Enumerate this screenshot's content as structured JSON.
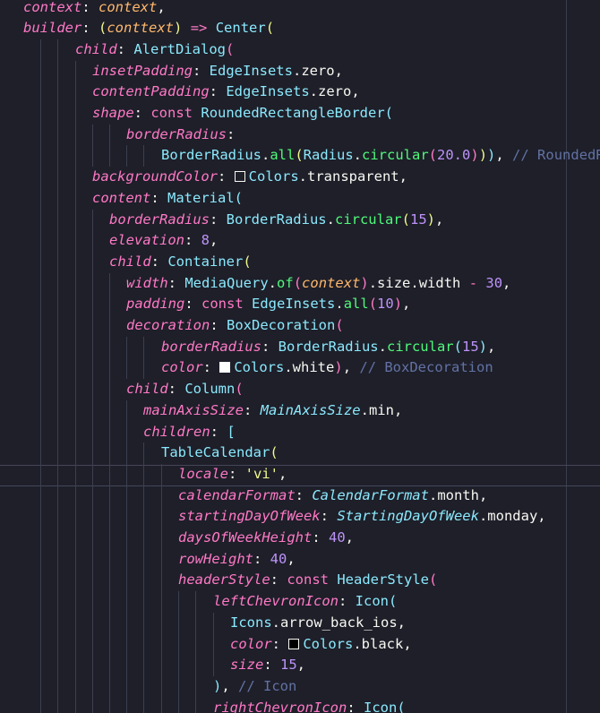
{
  "editor": {
    "language": "dart",
    "theme_colors": {
      "background": "#1e1f29",
      "param": "#ff79c6",
      "class": "#8be9fd",
      "function": "#50fa7b",
      "number": "#bd93f9",
      "string": "#f1fa8c",
      "comment": "#6272a4"
    },
    "lines": [
      {
        "tokens": [
          [
            "pn",
            "context"
          ],
          [
            "pu",
            ": "
          ],
          [
            "vi",
            "context"
          ],
          [
            "pu",
            ","
          ]
        ]
      },
      {
        "tokens": [
          [
            "pn",
            "builder"
          ],
          [
            "pu",
            ": "
          ],
          [
            "p1",
            "("
          ],
          [
            "vi",
            "conttext"
          ],
          [
            "p1",
            ")"
          ],
          [
            "pu",
            " "
          ],
          [
            "kw",
            "=>"
          ],
          [
            "pu",
            " "
          ],
          [
            "cl",
            "Center"
          ],
          [
            "p1",
            "("
          ]
        ]
      },
      {
        "tokens": [
          [
            "pn",
            "child"
          ],
          [
            "pu",
            ": "
          ],
          [
            "cl",
            "AlertDialog"
          ],
          [
            "p2",
            "("
          ]
        ]
      },
      {
        "tokens": [
          [
            "pn",
            "insetPadding"
          ],
          [
            "pu",
            ": "
          ],
          [
            "cl",
            "EdgeInsets"
          ],
          [
            "pu",
            ".zero,"
          ]
        ]
      },
      {
        "tokens": [
          [
            "pn",
            "contentPadding"
          ],
          [
            "pu",
            ": "
          ],
          [
            "cl",
            "EdgeInsets"
          ],
          [
            "pu",
            ".zero,"
          ]
        ]
      },
      {
        "tokens": [
          [
            "pn",
            "shape"
          ],
          [
            "pu",
            ": "
          ],
          [
            "kw",
            "const"
          ],
          [
            "pu",
            " "
          ],
          [
            "cl",
            "RoundedRectangleBorder"
          ],
          [
            "p3",
            "("
          ]
        ]
      },
      {
        "tokens": [
          [
            "pn",
            "borderRadius"
          ],
          [
            "pu",
            ":"
          ]
        ]
      },
      {
        "tokens": [
          [
            "cl",
            "BorderRadius"
          ],
          [
            "pu",
            "."
          ],
          [
            "fn",
            "all"
          ],
          [
            "p1",
            "("
          ],
          [
            "cl",
            "Radius"
          ],
          [
            "pu",
            "."
          ],
          [
            "fn",
            "circular"
          ],
          [
            "p2",
            "("
          ],
          [
            "nm",
            "20.0"
          ],
          [
            "p2",
            ")"
          ],
          [
            "p1",
            ")"
          ],
          [
            "p3",
            ")"
          ],
          [
            "pu",
            ", "
          ],
          [
            "cm",
            "// RoundedRectangleBorder"
          ]
        ]
      },
      {
        "tokens": [
          [
            "pn",
            "backgroundColor"
          ],
          [
            "pu",
            ": "
          ],
          [
            "sw",
            "#1e1f29"
          ],
          [
            "cl",
            "Colors"
          ],
          [
            "pu",
            ".transparent,"
          ]
        ]
      },
      {
        "tokens": [
          [
            "pn",
            "content"
          ],
          [
            "pu",
            ": "
          ],
          [
            "cl",
            "Material"
          ],
          [
            "p3",
            "("
          ]
        ]
      },
      {
        "tokens": [
          [
            "pn",
            "borderRadius"
          ],
          [
            "pu",
            ": "
          ],
          [
            "cl",
            "BorderRadius"
          ],
          [
            "pu",
            "."
          ],
          [
            "fn",
            "circular"
          ],
          [
            "p1",
            "("
          ],
          [
            "nm",
            "15"
          ],
          [
            "p1",
            ")"
          ],
          [
            "pu",
            ","
          ]
        ]
      },
      {
        "tokens": [
          [
            "pn",
            "elevation"
          ],
          [
            "pu",
            ": "
          ],
          [
            "nm",
            "8"
          ],
          [
            "pu",
            ","
          ]
        ]
      },
      {
        "tokens": [
          [
            "pn",
            "child"
          ],
          [
            "pu",
            ": "
          ],
          [
            "cl",
            "Container"
          ],
          [
            "p1",
            "("
          ]
        ]
      },
      {
        "tokens": [
          [
            "pn",
            "width"
          ],
          [
            "pu",
            ": "
          ],
          [
            "cl",
            "MediaQuery"
          ],
          [
            "pu",
            "."
          ],
          [
            "fn",
            "of"
          ],
          [
            "p2",
            "("
          ],
          [
            "vi",
            "context"
          ],
          [
            "p2",
            ")"
          ],
          [
            "pu",
            ".size.width "
          ],
          [
            "kw",
            "-"
          ],
          [
            "pu",
            " "
          ],
          [
            "nm",
            "30"
          ],
          [
            "pu",
            ","
          ]
        ]
      },
      {
        "tokens": [
          [
            "pn",
            "padding"
          ],
          [
            "pu",
            ": "
          ],
          [
            "kw",
            "const"
          ],
          [
            "pu",
            " "
          ],
          [
            "cl",
            "EdgeInsets"
          ],
          [
            "pu",
            "."
          ],
          [
            "fn",
            "all"
          ],
          [
            "p2",
            "("
          ],
          [
            "nm",
            "10"
          ],
          [
            "p2",
            ")"
          ],
          [
            "pu",
            ","
          ]
        ]
      },
      {
        "tokens": [
          [
            "pn",
            "decoration"
          ],
          [
            "pu",
            ": "
          ],
          [
            "cl",
            "BoxDecoration"
          ],
          [
            "p2",
            "("
          ]
        ]
      },
      {
        "tokens": [
          [
            "pn",
            "borderRadius"
          ],
          [
            "pu",
            ": "
          ],
          [
            "cl",
            "BorderRadius"
          ],
          [
            "pu",
            "."
          ],
          [
            "fn",
            "circular"
          ],
          [
            "p3",
            "("
          ],
          [
            "nm",
            "15"
          ],
          [
            "p3",
            ")"
          ],
          [
            "pu",
            ","
          ]
        ]
      },
      {
        "tokens": [
          [
            "pn",
            "color"
          ],
          [
            "pu",
            ": "
          ],
          [
            "sw",
            "#ffffff"
          ],
          [
            "cl",
            "Colors"
          ],
          [
            "pu",
            ".white"
          ],
          [
            "p2",
            ")"
          ],
          [
            "pu",
            ", "
          ],
          [
            "cm",
            "// BoxDecoration"
          ]
        ]
      },
      {
        "tokens": [
          [
            "pn",
            "child"
          ],
          [
            "pu",
            ": "
          ],
          [
            "cl",
            "Column"
          ],
          [
            "p2",
            "("
          ]
        ]
      },
      {
        "tokens": [
          [
            "pn",
            "mainAxisSize"
          ],
          [
            "pu",
            ": "
          ],
          [
            "cli",
            "MainAxisSize"
          ],
          [
            "pu",
            ".min,"
          ]
        ]
      },
      {
        "tokens": [
          [
            "pn",
            "children"
          ],
          [
            "pu",
            ": "
          ],
          [
            "p3",
            "["
          ]
        ]
      },
      {
        "tokens": [
          [
            "cl",
            "TableCalendar"
          ],
          [
            "p1",
            "("
          ]
        ]
      },
      {
        "tokens": [
          [
            "pn",
            "locale"
          ],
          [
            "pu",
            ": "
          ],
          [
            "st",
            "'vi'"
          ],
          [
            "pu",
            ","
          ]
        ]
      },
      {
        "tokens": [
          [
            "pn",
            "calendarFormat"
          ],
          [
            "pu",
            ": "
          ],
          [
            "cli",
            "CalendarFormat"
          ],
          [
            "pu",
            ".month,"
          ]
        ]
      },
      {
        "tokens": [
          [
            "pn",
            "startingDayOfWeek"
          ],
          [
            "pu",
            ": "
          ],
          [
            "cli",
            "StartingDayOfWeek"
          ],
          [
            "pu",
            ".monday,"
          ]
        ]
      },
      {
        "tokens": [
          [
            "pn",
            "daysOfWeekHeight"
          ],
          [
            "pu",
            ": "
          ],
          [
            "nm",
            "40"
          ],
          [
            "pu",
            ","
          ]
        ]
      },
      {
        "tokens": [
          [
            "pn",
            "rowHeight"
          ],
          [
            "pu",
            ": "
          ],
          [
            "nm",
            "40"
          ],
          [
            "pu",
            ","
          ]
        ]
      },
      {
        "tokens": [
          [
            "pn",
            "headerStyle"
          ],
          [
            "pu",
            ": "
          ],
          [
            "kw",
            "const"
          ],
          [
            "pu",
            " "
          ],
          [
            "cl",
            "HeaderStyle"
          ],
          [
            "p2",
            "("
          ]
        ]
      },
      {
        "tokens": [
          [
            "pn",
            "leftChevronIcon"
          ],
          [
            "pu",
            ": "
          ],
          [
            "cl",
            "Icon"
          ],
          [
            "p3",
            "("
          ]
        ]
      },
      {
        "tokens": [
          [
            "cl",
            "Icons"
          ],
          [
            "pu",
            ".arrow_back_ios,"
          ]
        ]
      },
      {
        "tokens": [
          [
            "pn",
            "color"
          ],
          [
            "pu",
            ": "
          ],
          [
            "sw",
            "#000000"
          ],
          [
            "cl",
            "Colors"
          ],
          [
            "pu",
            ".black,"
          ]
        ]
      },
      {
        "tokens": [
          [
            "pn",
            "size"
          ],
          [
            "pu",
            ": "
          ],
          [
            "nm",
            "15"
          ],
          [
            "pu",
            ","
          ]
        ]
      },
      {
        "tokens": [
          [
            "p3",
            ")"
          ],
          [
            "pu",
            ", "
          ],
          [
            "cm",
            "// Icon"
          ]
        ]
      },
      {
        "tokens": [
          [
            "pn",
            "rightChevronIcon"
          ],
          [
            "pu",
            ": "
          ],
          [
            "cl",
            "Icon"
          ],
          [
            "p3",
            "("
          ]
        ]
      }
    ]
  }
}
